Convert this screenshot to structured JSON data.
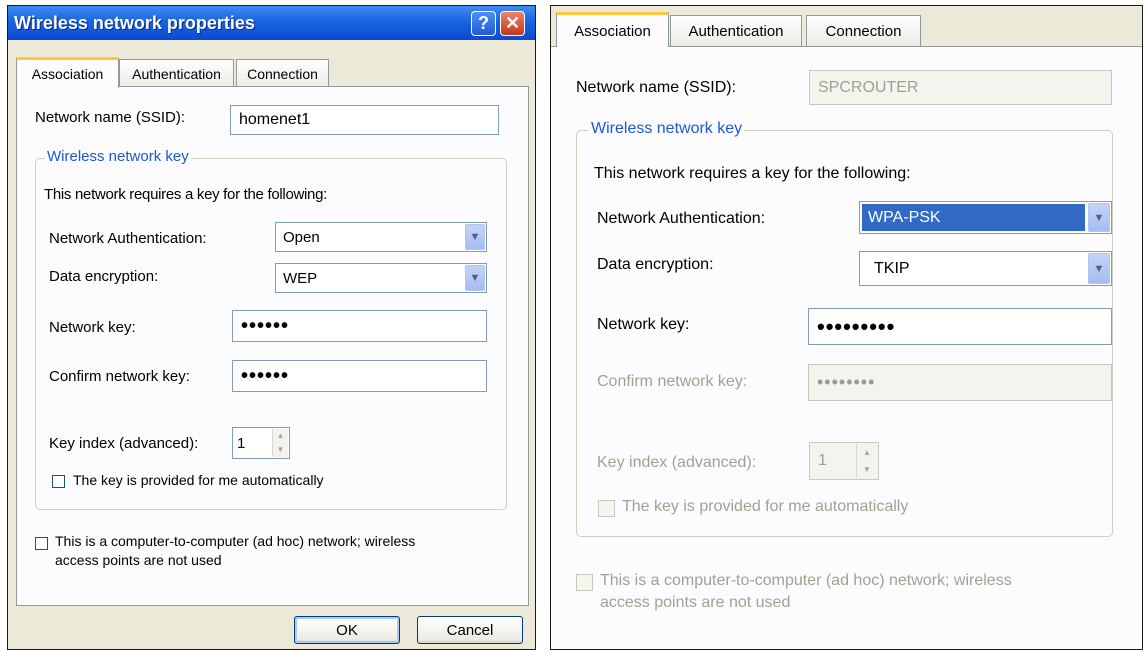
{
  "left": {
    "title": "Wireless network properties",
    "help_glyph": "?",
    "close_glyph": "✕",
    "tabs": [
      "Association",
      "Authentication",
      "Connection"
    ],
    "ssid_label": "Network name (SSID):",
    "ssid_value": "homenet1",
    "group_legend": "Wireless network key",
    "requires_text": "This network requires a key for the following:",
    "auth_label": "Network Authentication:",
    "auth_value": "Open",
    "enc_label": "Data encryption:",
    "enc_value": "WEP",
    "key_label": "Network key:",
    "key_value": "••••••",
    "confirm_label": "Confirm network key:",
    "confirm_value": "••••••",
    "index_label": "Key index (advanced):",
    "index_value": "1",
    "auto_key_label": "The key is provided for me automatically",
    "adhoc_line1": "This is a computer-to-computer (ad hoc) network; wireless",
    "adhoc_line2": "access points are not used",
    "ok_label": "OK",
    "cancel_label": "Cancel"
  },
  "right": {
    "tabs": [
      "Association",
      "Authentication",
      "Connection"
    ],
    "ssid_label": "Network name (SSID):",
    "ssid_value": "SPCROUTER",
    "group_legend": "Wireless network key",
    "requires_text": "This network requires a key for the following:",
    "auth_label": "Network Authentication:",
    "auth_value": "WPA-PSK",
    "enc_label": "Data encryption:",
    "enc_value": "TKIP",
    "key_label": "Network key:",
    "key_value": "•••••••••",
    "confirm_label": "Confirm network key:",
    "confirm_value": "••••••••",
    "index_label": "Key index (advanced):",
    "index_value": "1",
    "auto_key_label": "The key is provided for me automatically",
    "adhoc_line1": "This is a computer-to-computer (ad hoc) network; wireless",
    "adhoc_line2": "access points are not used"
  },
  "colors": {
    "titlebar": "#0a4ad0",
    "accent_tab": "#ffc83c",
    "group_legend": "#1c57d4",
    "selection": "#316ac5",
    "disabled_text": "#a1a192"
  },
  "icons": {
    "help": "help-icon",
    "close": "close-icon",
    "dropdown": "chevron-down-icon",
    "spin_up": "spin-up-icon",
    "spin_down": "spin-down-icon"
  }
}
